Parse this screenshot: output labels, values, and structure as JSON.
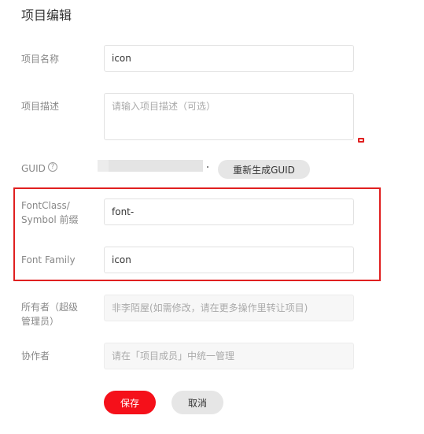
{
  "page": {
    "title": "项目编辑"
  },
  "form": {
    "name": {
      "label": "项目名称",
      "value": "icon"
    },
    "description": {
      "label": "项目描述",
      "placeholder": "请输入项目描述（可选）",
      "value": ""
    },
    "guid": {
      "label": "GUID",
      "help_icon": "?",
      "regenerate_label": "重新生成GUID"
    },
    "font_class": {
      "label_line1": "FontClass/",
      "label_line2": "Symbol 前缀",
      "value": "font-"
    },
    "font_family": {
      "label": "Font Family",
      "value": "icon"
    },
    "owner": {
      "label_line1": "所有者（超级",
      "label_line2": "管理员）",
      "placeholder": "非李陌屋(如需修改，请在更多操作里转让项目)"
    },
    "collaborators": {
      "label": "协作者",
      "placeholder": "请在「项目成员」中统一管理"
    }
  },
  "actions": {
    "save_label": "保存",
    "cancel_label": "取消"
  },
  "colors": {
    "accent": "#f5101a",
    "highlight_border": "#e02020",
    "label": "#888888",
    "border": "#e1e1e1"
  },
  "icons": {
    "help": "question-circle-icon",
    "resize": "resize-handle-icon"
  }
}
